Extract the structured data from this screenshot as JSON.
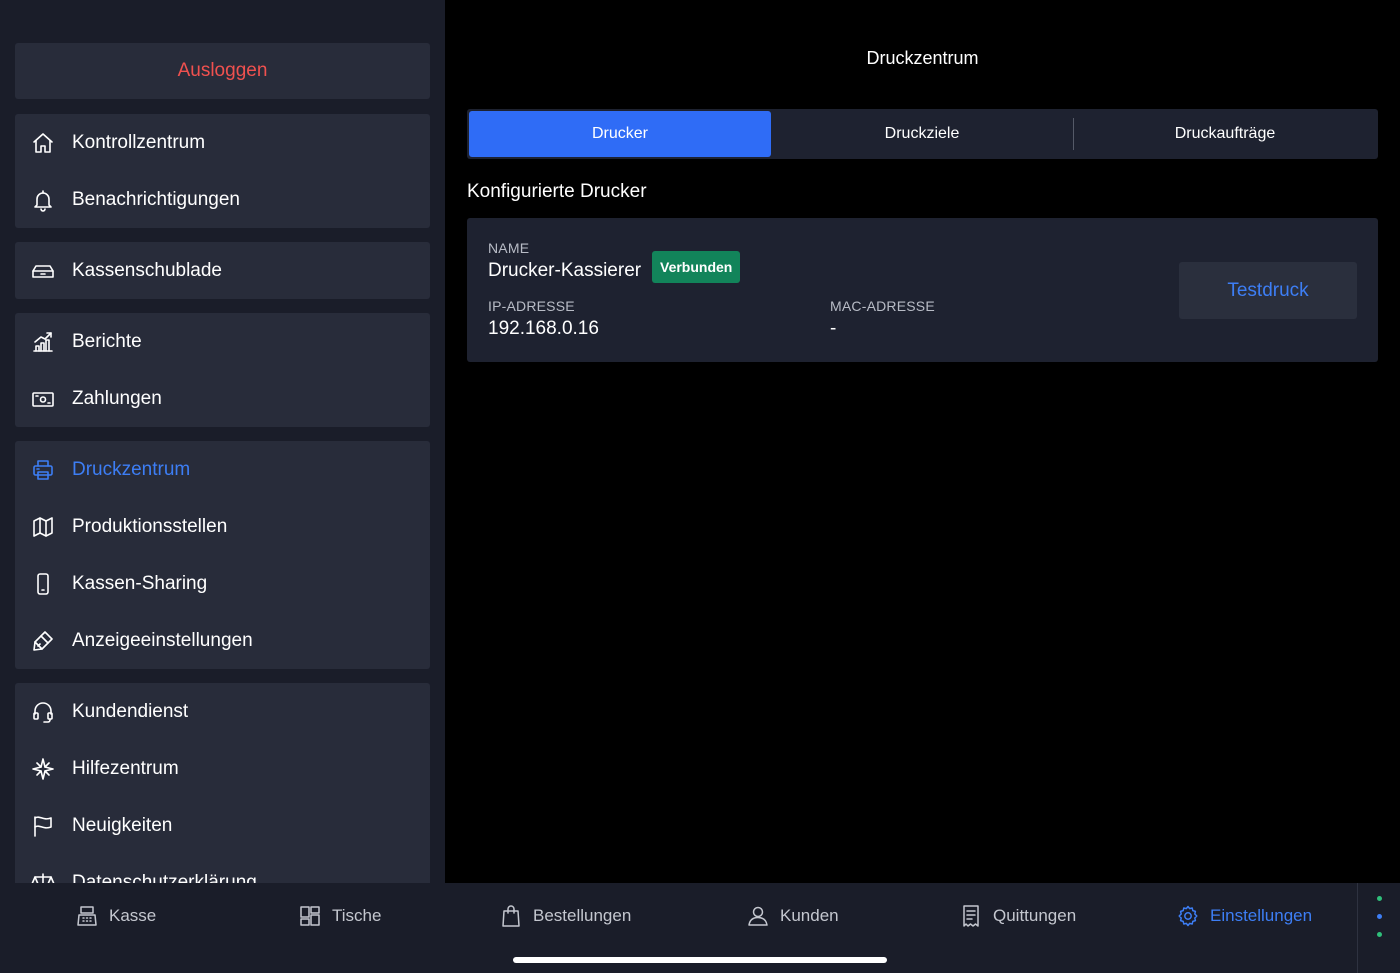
{
  "sidebar": {
    "logout_label": "Ausloggen",
    "groups": [
      {
        "items": [
          {
            "label": "Kontrollzentrum",
            "icon": "home-icon"
          },
          {
            "label": "Benachrichtigungen",
            "icon": "bell-icon"
          }
        ]
      },
      {
        "items": [
          {
            "label": "Kassenschublade",
            "icon": "drawer-icon"
          }
        ]
      },
      {
        "items": [
          {
            "label": "Berichte",
            "icon": "chart-icon"
          },
          {
            "label": "Zahlungen",
            "icon": "money-icon"
          }
        ]
      },
      {
        "items": [
          {
            "label": "Druckzentrum",
            "icon": "printer-icon",
            "active": true
          },
          {
            "label": "Produktionsstellen",
            "icon": "map-icon"
          },
          {
            "label": "Kassen-Sharing",
            "icon": "phone-icon"
          },
          {
            "label": "Anzeigeeinstellungen",
            "icon": "brush-icon"
          }
        ]
      },
      {
        "items": [
          {
            "label": "Kundendienst",
            "icon": "headset-icon"
          },
          {
            "label": "Hilfezentrum",
            "icon": "compass-icon"
          },
          {
            "label": "Neuigkeiten",
            "icon": "flag-icon"
          },
          {
            "label": "Datenschutzerklärung",
            "icon": "scale-icon"
          }
        ]
      }
    ]
  },
  "main": {
    "title": "Druckzentrum",
    "tabs": [
      {
        "label": "Drucker",
        "active": true
      },
      {
        "label": "Druckziele"
      },
      {
        "label": "Druckaufträge"
      }
    ],
    "section_title": "Konfigurierte Drucker",
    "printer": {
      "name_label": "NAME",
      "name": "Drucker-Kassierer",
      "status": "Verbunden",
      "ip_label": "IP-ADRESSE",
      "ip": "192.168.0.16",
      "mac_label": "MAC-ADRESSE",
      "mac": "-",
      "test_button": "Testdruck"
    }
  },
  "bottom_nav": [
    {
      "label": "Kasse",
      "icon": "register-icon"
    },
    {
      "label": "Tische",
      "icon": "tables-icon"
    },
    {
      "label": "Bestellungen",
      "icon": "bag-icon"
    },
    {
      "label": "Kunden",
      "icon": "user-icon"
    },
    {
      "label": "Quittungen",
      "icon": "receipt-icon"
    },
    {
      "label": "Einstellungen",
      "icon": "gear-icon",
      "active": true
    }
  ],
  "colors": {
    "accent": "#3d7ef5",
    "tab_active": "#2f6cf6",
    "logout": "#f0514f",
    "badge": "#12845a",
    "sidebar_bg": "#1a1d29",
    "panel_bg": "#282c3a"
  }
}
